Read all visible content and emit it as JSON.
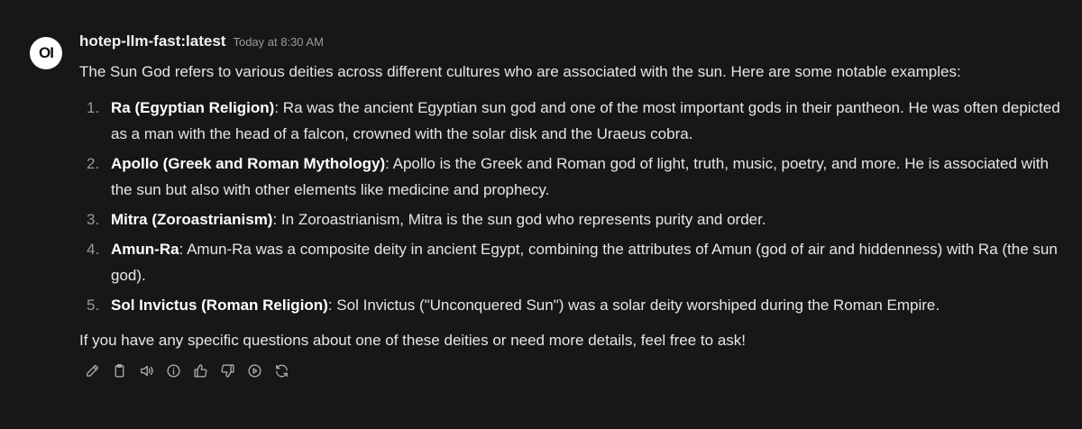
{
  "avatar": {
    "label": "OI"
  },
  "message": {
    "model": "hotep-llm-fast:latest",
    "timestamp": "Today at 8:30 AM",
    "intro": "The Sun God refers to various deities across different cultures who are associated with the sun. Here are some notable examples:",
    "items": [
      {
        "number": "1.",
        "term": "Ra (Egyptian Religion)",
        "text": ": Ra was the ancient Egyptian sun god and one of the most important gods in their pantheon. He was often depicted as a man with the head of a falcon, crowned with the solar disk and the Uraeus cobra."
      },
      {
        "number": "2.",
        "term": "Apollo (Greek and Roman Mythology)",
        "text": ": Apollo is the Greek and Roman god of light, truth, music, poetry, and more. He is associated with the sun but also with other elements like medicine and prophecy."
      },
      {
        "number": "3.",
        "term": "Mitra (Zoroastrianism)",
        "text": ": In Zoroastrianism, Mitra is the sun god who represents purity and order."
      },
      {
        "number": "4.",
        "term": "Amun-Ra",
        "text": ": Amun-Ra was a composite deity in ancient Egypt, combining the attributes of Amun (god of air and hiddenness) with Ra (the sun god)."
      },
      {
        "number": "5.",
        "term": "Sol Invictus (Roman Religion)",
        "text": ": Sol Invictus (\"Unconquered Sun\") was a solar deity worshiped during the Roman Empire."
      }
    ],
    "outro": "If you have any specific questions about one of these deities or need more details, feel free to ask!"
  },
  "actions": [
    {
      "icon": "pencil-icon",
      "name": "edit-button"
    },
    {
      "icon": "clipboard-icon",
      "name": "copy-button"
    },
    {
      "icon": "speaker-icon",
      "name": "read-aloud-button"
    },
    {
      "icon": "info-icon",
      "name": "generation-info-button"
    },
    {
      "icon": "thumbs-up-icon",
      "name": "good-response-button"
    },
    {
      "icon": "thumbs-down-icon",
      "name": "bad-response-button"
    },
    {
      "icon": "play-circle-icon",
      "name": "continue-response-button"
    },
    {
      "icon": "refresh-icon",
      "name": "regenerate-button"
    }
  ],
  "colors": {
    "background": "#171717",
    "text": "#e6e6e6",
    "muted": "#9a9a9a",
    "avatar_bg": "#ffffff"
  }
}
